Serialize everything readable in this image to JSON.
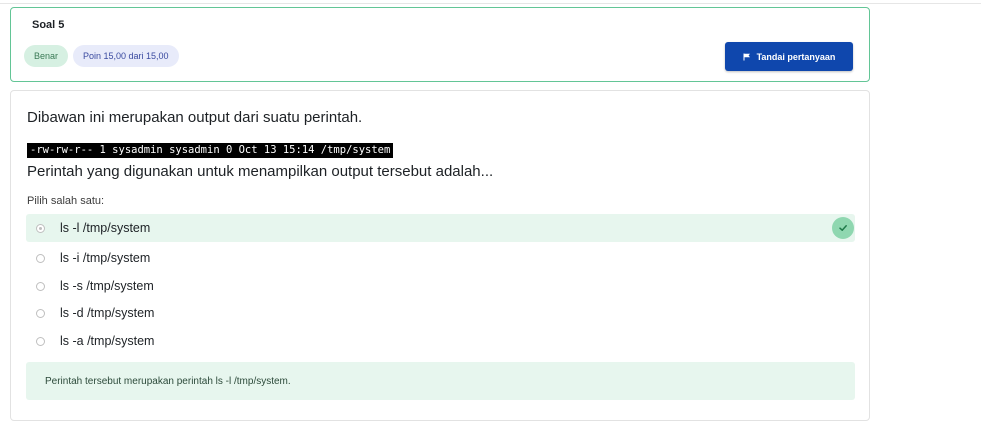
{
  "info": {
    "question_number": "Soal 5",
    "status": "Benar",
    "points": "Poin 15,00 dari 15,00",
    "flag_button": "Tandai pertanyaan"
  },
  "question": {
    "intro": "Dibawan ini merupakan output dari suatu perintah.",
    "code": "-rw-rw-r-- 1 sysadmin sysadmin 0 Oct 13 15:14 /tmp/system",
    "text": "Perintah yang digunakan untuk menampilkan output tersebut adalah...",
    "prompt": "Pilih salah satu:",
    "options": [
      {
        "label": "ls -l /tmp/system",
        "selected": true,
        "correct": true
      },
      {
        "label": "ls -i /tmp/system",
        "selected": false,
        "correct": false
      },
      {
        "label": "ls -s /tmp/system",
        "selected": false,
        "correct": false
      },
      {
        "label": "ls -d /tmp/system",
        "selected": false,
        "correct": false
      },
      {
        "label": "ls -a /tmp/system",
        "selected": false,
        "correct": false
      }
    ],
    "feedback": "Perintah tersebut merupakan perintah ls -l /tmp/system."
  },
  "colors": {
    "accent": "#0f47ad",
    "correct_border": "#63c596",
    "correct_bg": "#e7f6ee",
    "check_bg": "#8fd7b0"
  },
  "icons": {
    "flag": "flag-icon",
    "check": "check-icon"
  }
}
